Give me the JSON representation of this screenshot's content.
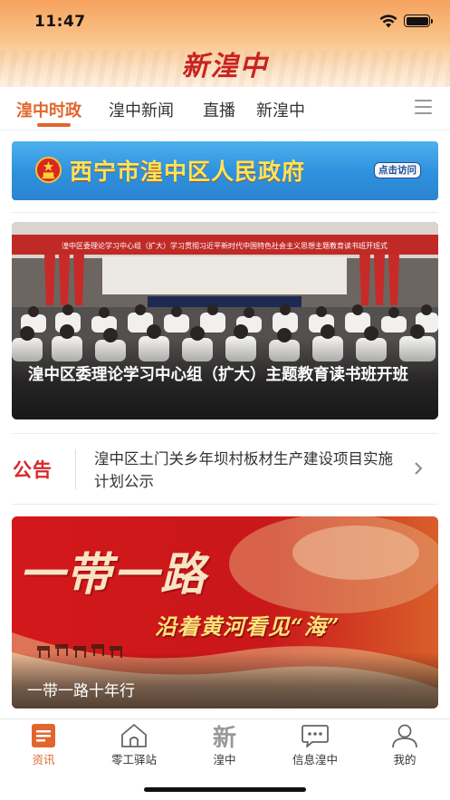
{
  "status_bar": {
    "time": "11:47",
    "wifi_icon": "wifi-icon",
    "battery_icon": "battery-icon"
  },
  "header": {
    "brand": "新湟中"
  },
  "tabs": [
    {
      "label": "湟中时政",
      "active": true
    },
    {
      "label": "湟中新闻",
      "active": false
    },
    {
      "label": "直播",
      "active": false
    },
    {
      "label": "新湟中",
      "active": false
    }
  ],
  "tab_menu_icon": "menu-icon",
  "gov_banner": {
    "title": "西宁市湟中区人民政府",
    "button_label": "点击访问",
    "emblem_icon": "national-emblem-icon"
  },
  "news_card": {
    "photo_banner_text": "湟中区委理论学习中心组（扩大）学习贯彻习近平新时代中国特色社会主义思想主题教育读书班开班式",
    "caption": "湟中区委理论学习中心组（扩大）主题教育读书班开班"
  },
  "notice": {
    "label": "公告",
    "text": "湟中区土门关乡年坝村板材生产建设项目实施计划公示",
    "chevron_icon": "chevron-right-icon"
  },
  "promo_card": {
    "title": "一带一路",
    "subtitle": "沿着黄河看见“海”",
    "caption": "一带一路十年行"
  },
  "bottom_nav": [
    {
      "label": "资讯",
      "icon": "news-icon",
      "active": true
    },
    {
      "label": "零工驿站",
      "icon": "house-icon",
      "active": false
    },
    {
      "label": "湟中",
      "icon": "xin-logo-icon",
      "active": false
    },
    {
      "label": "信息湟中",
      "icon": "chat-bubble-icon",
      "active": false
    },
    {
      "label": "我的",
      "icon": "user-icon",
      "active": false
    }
  ],
  "colors": {
    "accent": "#e2652c",
    "notice_red": "#d7282a",
    "banner_blue": "#2f92de",
    "banner_gold": "#ffe35a",
    "promo_red": "#c4191c"
  }
}
